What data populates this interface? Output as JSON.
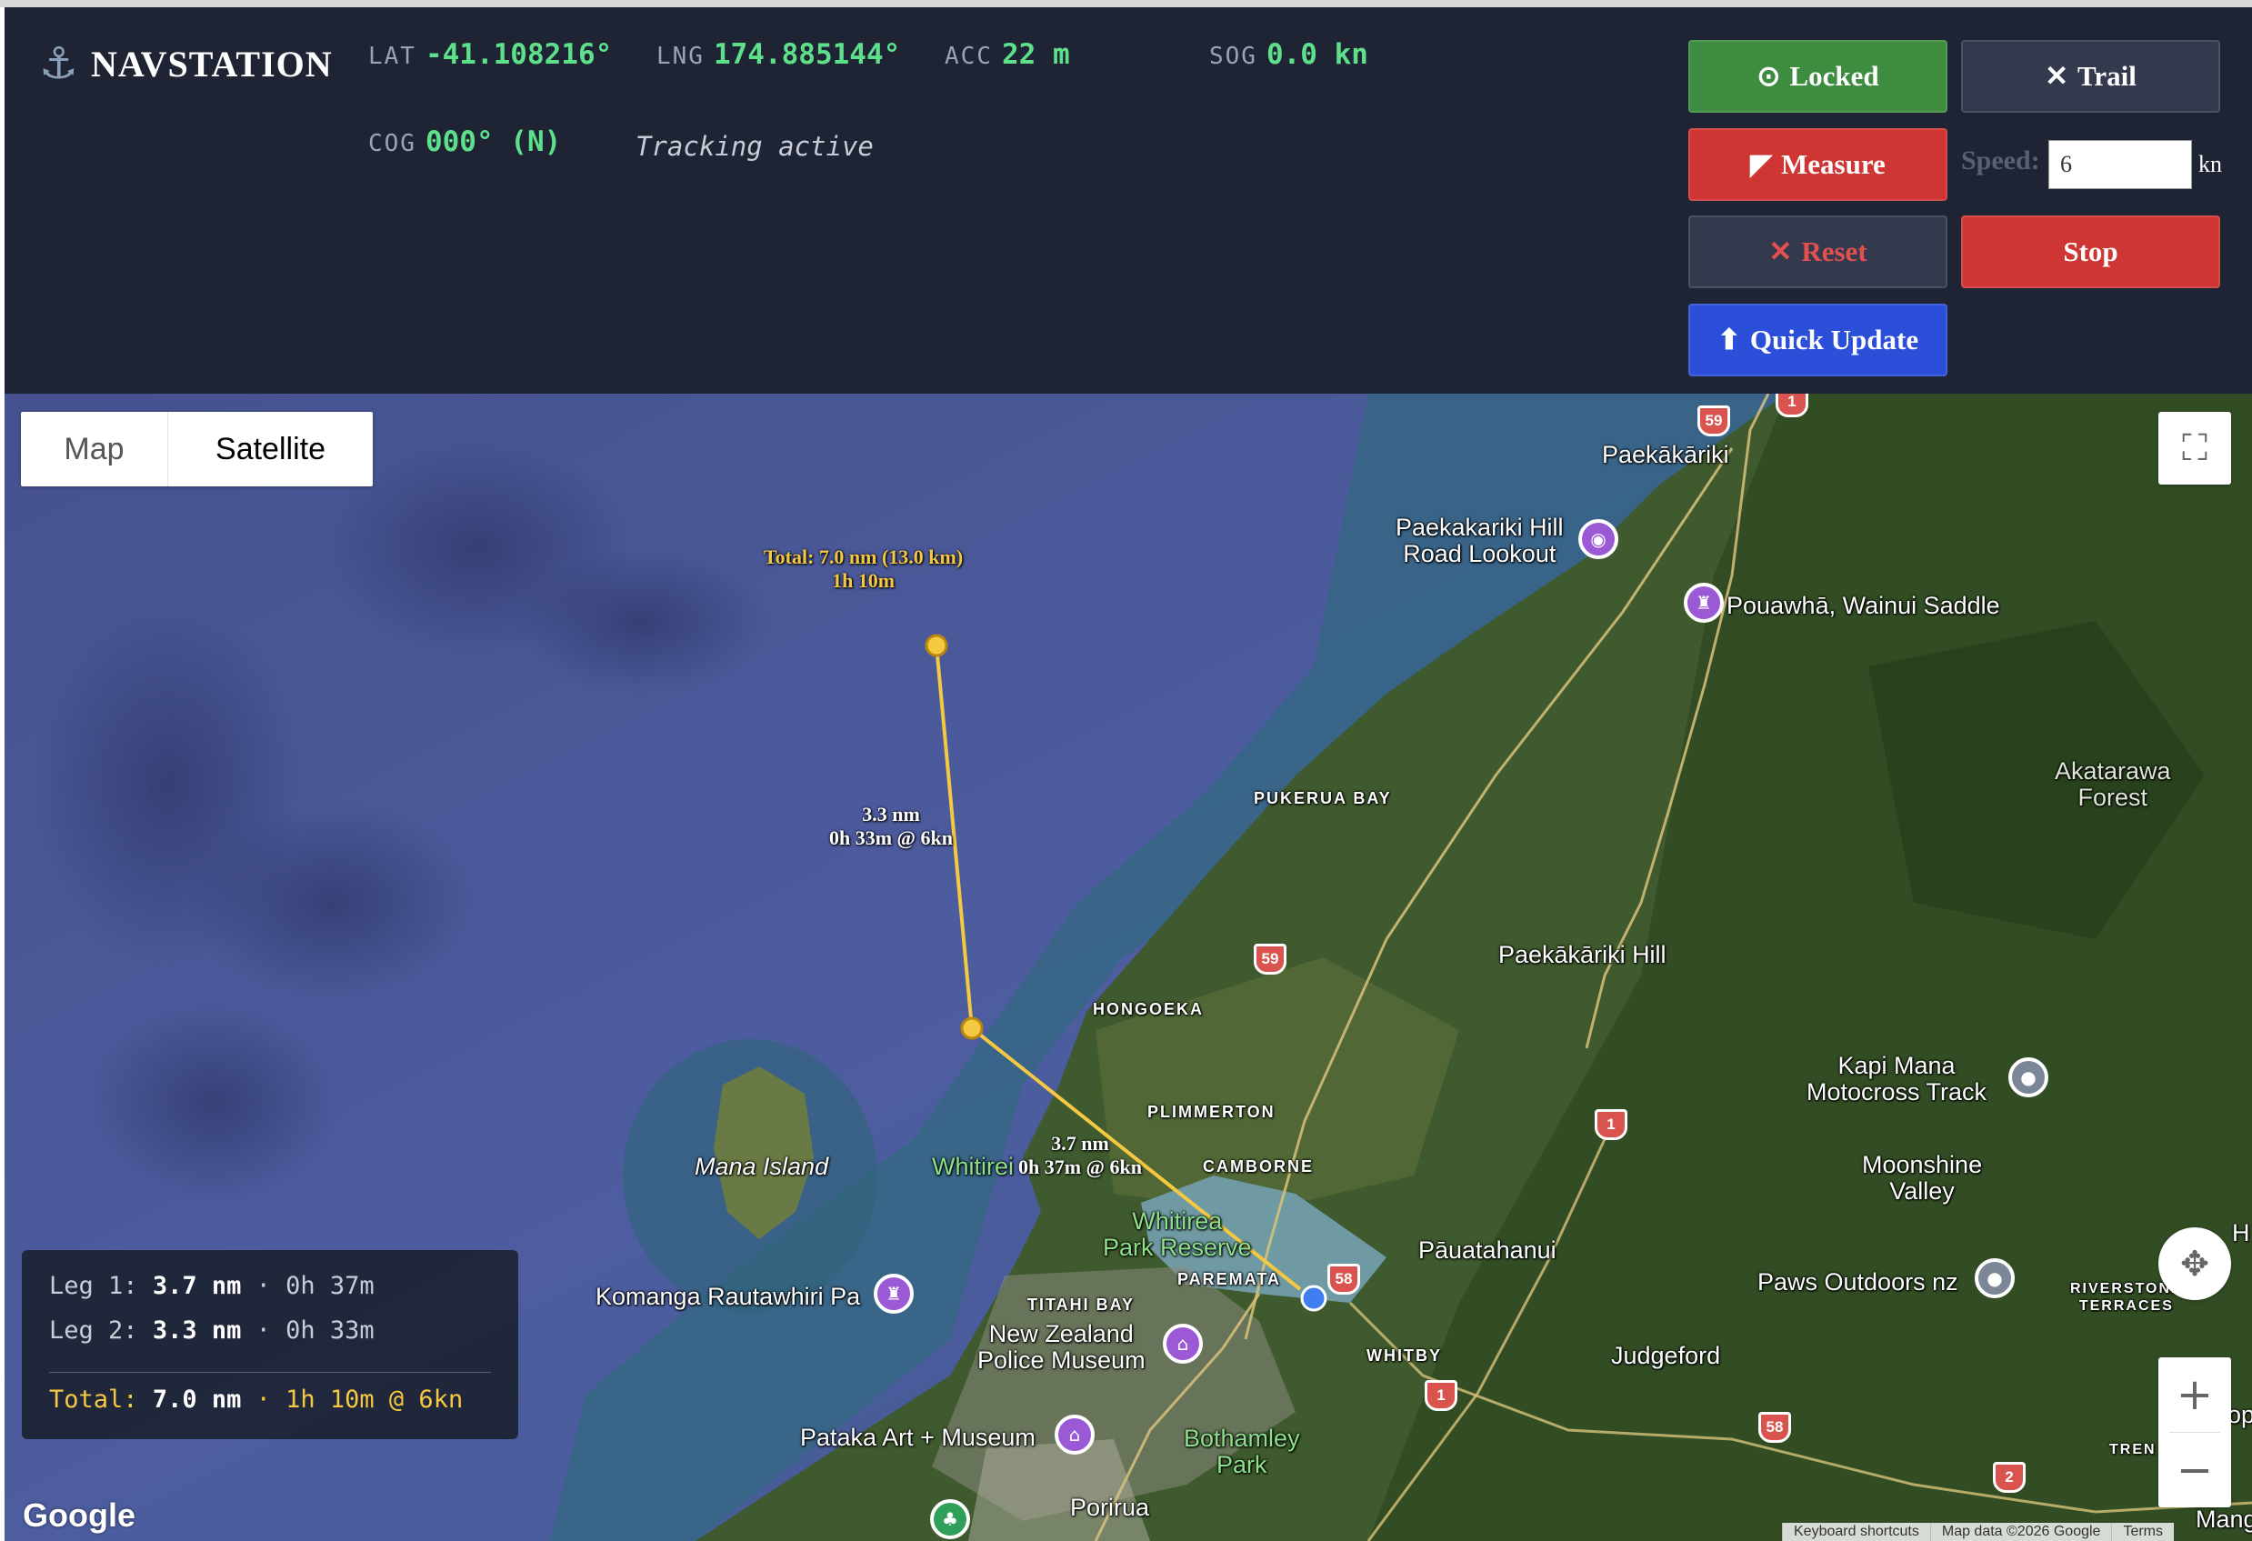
{
  "header": {
    "brand": "NAVSTATION",
    "brand_icon": "anchor-icon",
    "lat_label": "LAT",
    "lat_value": "-41.108216°",
    "lng_label": "LNG",
    "lng_value": "174.885144°",
    "acc_label": "ACC",
    "acc_value": "22 m",
    "sog_label": "SOG",
    "sog_value": "0.0 kn",
    "cog_label": "COG",
    "cog_value": "000° (N)",
    "status": "Tracking active"
  },
  "controls": {
    "locked_label": "Locked",
    "locked_icon": "⊙",
    "trail_label": "Trail",
    "trail_icon": "✕",
    "measure_label": "Measure",
    "measure_icon": "◤",
    "reset_label": "Reset",
    "reset_icon": "✕",
    "stop_label": "Stop",
    "quick_update_label": "Quick Update",
    "quick_update_icon": "⬆",
    "speed_label": "Speed:",
    "speed_value": "6",
    "speed_unit": "kn"
  },
  "colors": {
    "panel": "#1f2435",
    "locked": "#3d8c40",
    "measure": "#cf3532",
    "quick_update": "#2b4fd8",
    "measure_line": "#f5c842",
    "stat_value": "#5ee08a"
  },
  "map": {
    "type_options": [
      "Map",
      "Satellite"
    ],
    "selected_type": "Satellite",
    "measure_total_label": "Total: 7.0 nm (13.0 km)",
    "measure_total_time": "1h 10m",
    "leg2_label": "3.3 nm",
    "leg2_time": "0h 33m @ 6kn",
    "leg1_label": "3.7 nm",
    "leg1_time": "0h 37m @ 6kn",
    "places": {
      "paekakariki": "Paekākāriki",
      "lookout_1": "Paekakariki Hill",
      "lookout_2": "Road Lookout",
      "saddle": "Pouawhā, Wainui Saddle",
      "akatarawa_1": "Akatarawa",
      "akatarawa_2": "Forest",
      "pukerua_bay": "PUKERUA BAY",
      "paekakariki_hill": "Paekākāriki Hill",
      "hongoeka": "HONGOEKA",
      "plimmerton": "PLIMMERTON",
      "kapi_mana_1": "Kapi Mana",
      "kapi_mana_2": "Motocross Track",
      "mana_island": "Mana Island",
      "whitirei": "Whitirei",
      "camborne": "CAMBORNE",
      "moonshine_1": "Moonshine",
      "moonshine_2": "Valley",
      "whitirea_1": "Whitirea",
      "whitirea_2": "Park Reserve",
      "pauatahanui": "Pāuatahanui",
      "paremata": "PAREMATA",
      "komanga": "Komanga Rautawhiri Pa",
      "paws": "Paws Outdoors nz",
      "riverstone_1": "RIVERSTONE",
      "riverstone_2": "TERRACES",
      "titahi_bay": "TITAHI BAY",
      "police_1": "New Zealand",
      "police_2": "Police Museum",
      "whitby": "WHITBY",
      "judgeford": "Judgeford",
      "pataka": "Pataka Art + Museum",
      "bothamley_1": "Bothamley",
      "bothamley_2": "Park",
      "porirua": "Porirua",
      "tren": "TREN",
      "edge_h": "H",
      "edge_op": "op",
      "edge_mang": "Mang"
    },
    "shields": [
      "1",
      "59",
      "59",
      "1",
      "58",
      "1",
      "58",
      "2"
    ],
    "google_logo": "Google",
    "attribution": [
      "Keyboard shortcuts",
      "Map data ©2026 Google",
      "Terms"
    ]
  },
  "legs_panel": {
    "leg1_label": "Leg 1:",
    "leg1_dist": "3.7 nm",
    "leg1_time": "· 0h 37m",
    "leg2_label": "Leg 2:",
    "leg2_dist": "3.3 nm",
    "leg2_time": "· 0h 33m",
    "total_label": "Total:",
    "total_dist": "7.0 nm",
    "total_time": "· 1h 10m @ 6kn"
  }
}
